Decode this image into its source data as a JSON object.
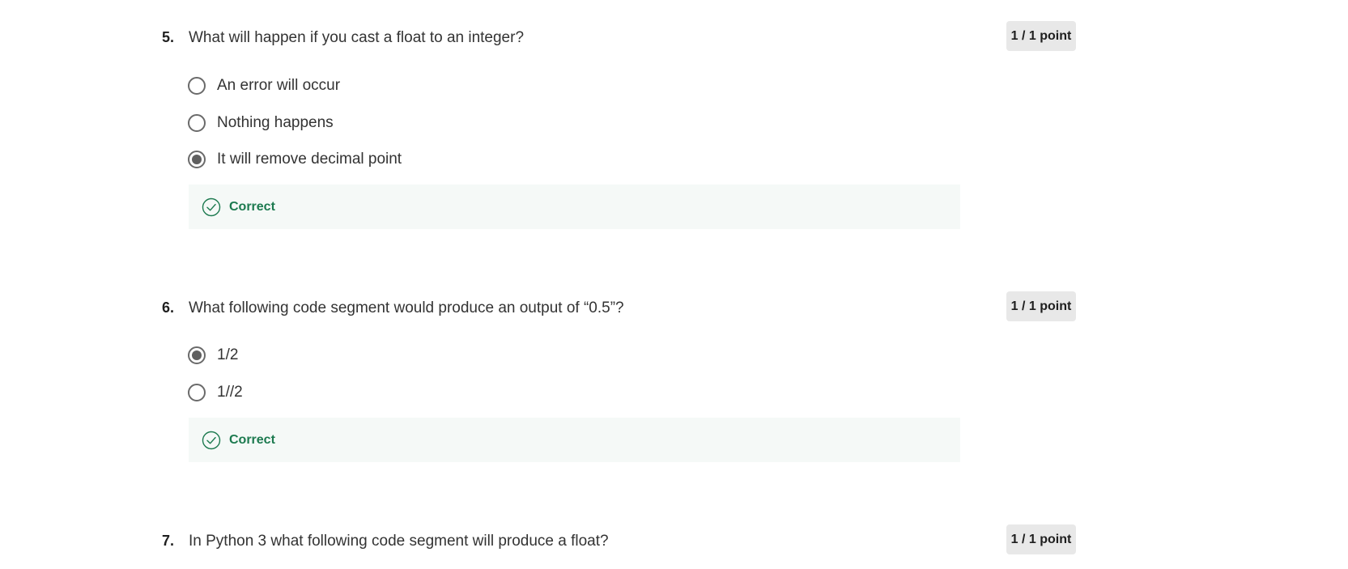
{
  "questions": [
    {
      "number": "5.",
      "text": "What will happen if you cast a float to an integer?",
      "points": "1 / 1 point",
      "options": [
        {
          "label": "An error will occur",
          "selected": false
        },
        {
          "label": "Nothing happens",
          "selected": false
        },
        {
          "label": "It will remove decimal point",
          "selected": true
        }
      ],
      "feedback": "Correct"
    },
    {
      "number": "6.",
      "text": "What following code segment would produce an output of “0.5”?",
      "points": "1 / 1 point",
      "options": [
        {
          "label": "1/2",
          "selected": true
        },
        {
          "label": "1//2",
          "selected": false
        }
      ],
      "feedback": "Correct"
    },
    {
      "number": "7.",
      "text": "In Python 3 what following code segment will produce a float?",
      "points": "1 / 1 point"
    }
  ],
  "colors": {
    "correct_green": "#1c7a4f",
    "feedback_bg": "#f5f9f7",
    "badge_bg": "#e8e8e8",
    "radio_border": "#6a6a6a"
  },
  "icons": {
    "feedback_icon": "check-circle-icon"
  }
}
